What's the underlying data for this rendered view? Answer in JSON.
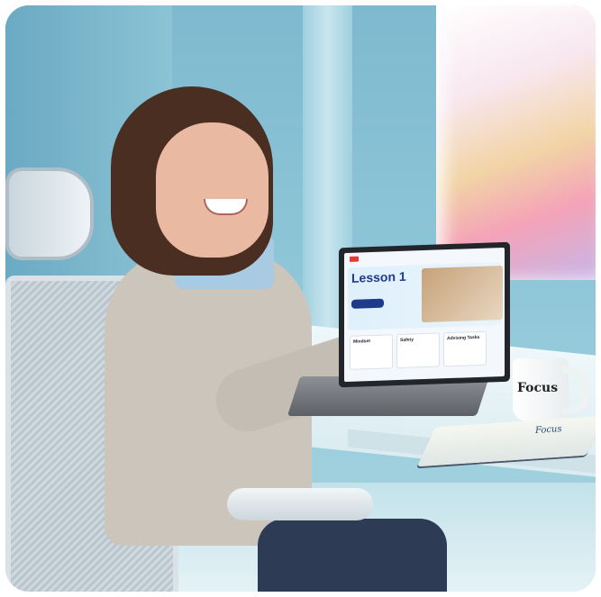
{
  "scene": {
    "laptop_screen": {
      "lesson_title": "Lesson 1",
      "cards": [
        "Mindset",
        "Safety",
        "Advising Tasks"
      ]
    },
    "mug_text": "Focus",
    "notebook_text": "Focus"
  }
}
